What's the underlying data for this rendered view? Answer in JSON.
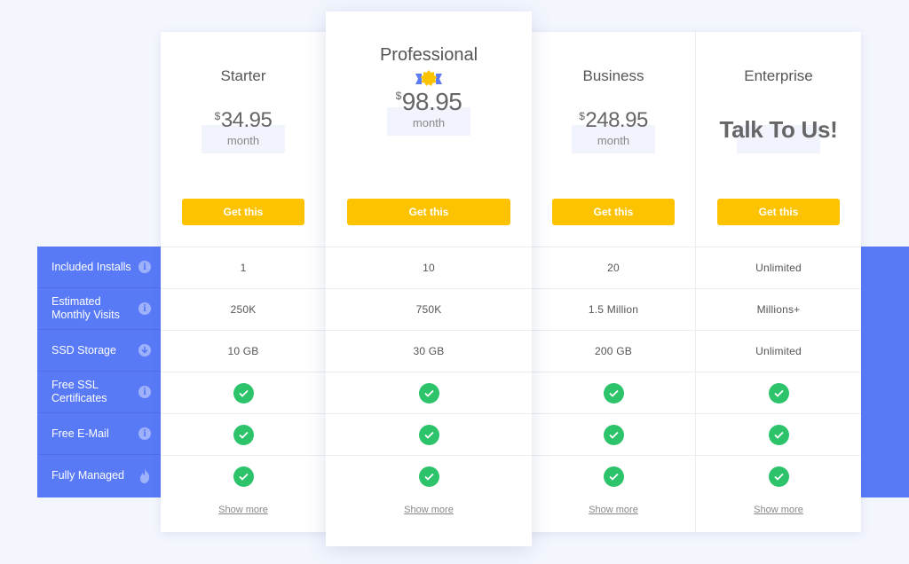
{
  "features": [
    {
      "label": "Included Installs",
      "icon": "info-icon"
    },
    {
      "label": "Estimated Monthly Visits",
      "icon": "info-icon"
    },
    {
      "label": "SSD Storage",
      "icon": "download-icon"
    },
    {
      "label": "Free SSL Certificates",
      "icon": "info-icon"
    },
    {
      "label": "Free E-Mail",
      "icon": "info-icon"
    },
    {
      "label": "Fully Managed",
      "icon": "flame-icon"
    }
  ],
  "plans": [
    {
      "name": "Starter",
      "currency": "$",
      "price": "34.95",
      "period": "month",
      "cta": "Get this",
      "values": [
        "1",
        "250K",
        "10 GB"
      ],
      "show_more": "Show more"
    },
    {
      "name": "Professional",
      "currency": "$",
      "price": "98.95",
      "period": "month",
      "cta": "Get this",
      "values": [
        "10",
        "750K",
        "30 GB"
      ],
      "show_more": "Show more"
    },
    {
      "name": "Business",
      "currency": "$",
      "price": "248.95",
      "period": "month",
      "cta": "Get this",
      "values": [
        "20",
        "1.5 Million",
        "200 GB"
      ],
      "show_more": "Show more"
    },
    {
      "name": "Enterprise",
      "price_text": "Talk To Us!",
      "cta": "Get this",
      "values": [
        "Unlimited",
        "Millions+",
        "Unlimited"
      ],
      "show_more": "Show more"
    }
  ],
  "colors": {
    "accent_blue": "#587af7",
    "button_yellow": "#fdc300",
    "check_green": "#2dc36a"
  }
}
